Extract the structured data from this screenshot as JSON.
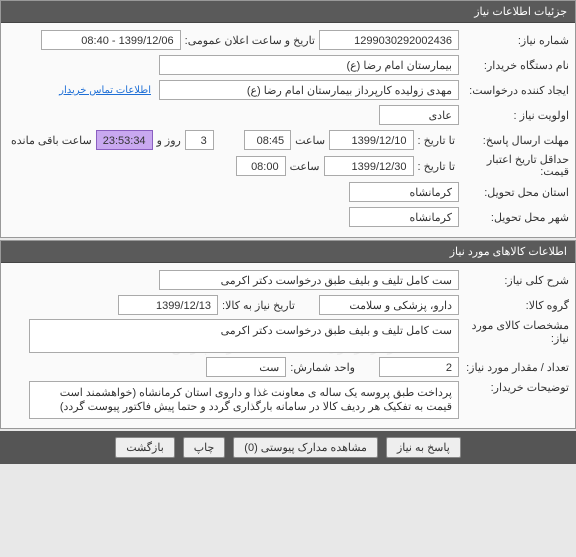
{
  "panel1": {
    "title": "جزئیات اطلاعات نیاز",
    "request_number_label": "شماره نیاز:",
    "request_number": "1299030292002436",
    "public_announce_label": "تاریخ و ساعت اعلان عمومی:",
    "public_announce": "1399/12/06 - 08:40",
    "buyer_device_label": "نام دستگاه خریدار:",
    "buyer_device": "بیمارستان امام رضا (ع)",
    "creator_label": "ایجاد کننده درخواست:",
    "creator": "مهدی زولیده کارپرداز بیمارستان امام رضا (ع)",
    "contact_link": "اطلاعات تماس خریدار",
    "priority_label": "اولویت نیاز :",
    "priority": "عادی",
    "deadline_label": "مهلت ارسال پاسخ:",
    "deadline_to_label": "تا تاریخ :",
    "deadline_date": "1399/12/10",
    "deadline_time_label": "ساعت",
    "deadline_time": "08:45",
    "days_count": "3",
    "days_and_label": "روز و",
    "countdown": "23:53:34",
    "remaining_label": "ساعت باقی مانده",
    "validity_label": "حداقل تاریخ اعتبار قیمت:",
    "validity_to_label": "تا تاریخ :",
    "validity_date": "1399/12/30",
    "validity_time_label": "ساعت",
    "validity_time": "08:00",
    "delivery_province_label": "استان محل تحویل:",
    "delivery_province": "کرمانشاه",
    "delivery_city_label": "شهر محل تحویل:",
    "delivery_city": "کرمانشاه"
  },
  "panel2": {
    "title": "اطلاعات کالاهای مورد نیاز",
    "general_desc_label": "شرح کلی نیاز:",
    "general_desc": "ست کامل تلیف و بلیف طبق درخواست دکتر اکرمی",
    "category_label": "گروه کالا:",
    "category": "دارو، پزشکی و سلامت",
    "need_date_label": "تاریخ نیاز به کالا:",
    "need_date": "1399/12/13",
    "item_spec_label": "مشخصات کالای مورد نیاز:",
    "item_spec": "ست کامل تلیف و بلیف طبق درخواست دکتر اکرمی",
    "quantity_label": "تعداد / مقدار مورد نیاز:",
    "quantity": "2",
    "unit_label": "واحد شمارش:",
    "unit": "ست",
    "buyer_notes_label": "توضیحات خریدار:",
    "buyer_notes": "پرداخت طبق پروسه یک ساله ی معاونت غذا و داروی استان کرمانشاه (خواهشمند است قیمت به تفکیک هر ردیف کالا در سامانه بارگذاری گردد و حتما پیش فاکتور پیوست گردد)"
  },
  "buttons": {
    "respond": "پاسخ به نیاز",
    "attachments": "مشاهده مدارک پیوستی (0)",
    "print": "چاپ",
    "back": "بازگشت"
  }
}
